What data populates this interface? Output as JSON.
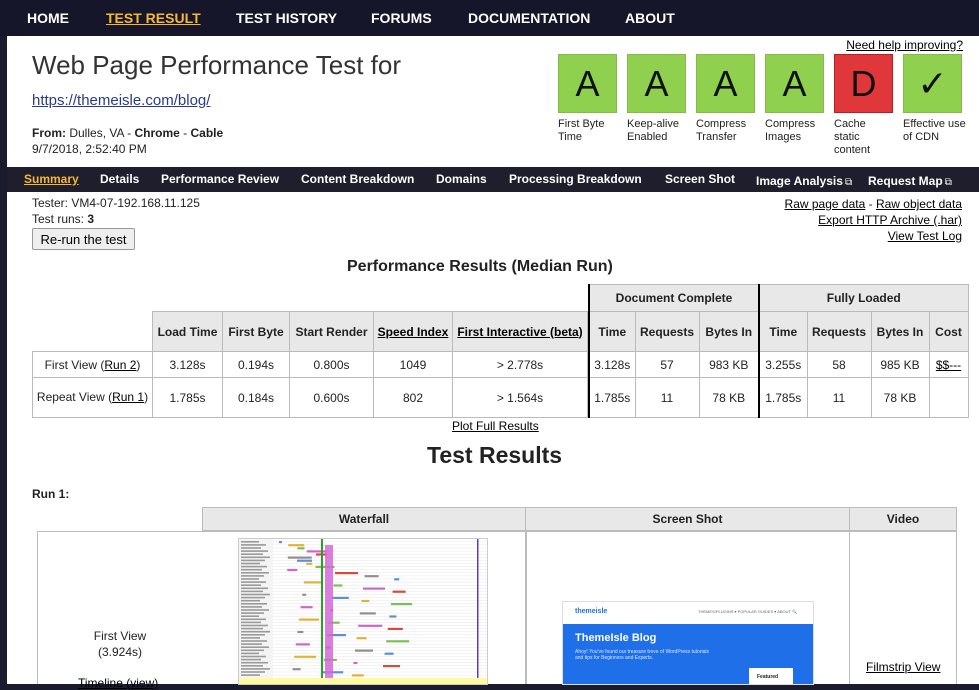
{
  "nav": {
    "items": [
      "HOME",
      "TEST RESULT",
      "TEST HISTORY",
      "FORUMS",
      "DOCUMENTATION",
      "ABOUT"
    ],
    "active": "TEST RESULT"
  },
  "header": {
    "help_link": "Need help improving?",
    "title": "Web Page Performance Test for",
    "url": "https://themeisle.com/blog/",
    "from_label": "From:",
    "from_location": "Dulles, VA",
    "from_sep": " - ",
    "browser": "Chrome",
    "connection": "Cable",
    "date": "9/7/2018, 2:52:40 PM"
  },
  "grades": [
    {
      "grade": "A",
      "label": "First Byte Time",
      "color": "#8fd14f"
    },
    {
      "grade": "A",
      "label": "Keep-alive Enabled",
      "color": "#8fd14f"
    },
    {
      "grade": "A",
      "label": "Compress Transfer",
      "color": "#8fd14f"
    },
    {
      "grade": "A",
      "label": "Compress Images",
      "color": "#8fd14f"
    },
    {
      "grade": "D",
      "label": "Cache static content",
      "color": "#e0383a"
    },
    {
      "grade": "✓",
      "label": "Effective use of CDN",
      "color": "#8fd14f"
    }
  ],
  "subnav": {
    "items": [
      "Summary",
      "Details",
      "Performance Review",
      "Content Breakdown",
      "Domains",
      "Processing Breakdown",
      "Screen Shot",
      "Image Analysis",
      "Request Map"
    ],
    "active": "Summary"
  },
  "test_info": {
    "tester_label": "Tester:",
    "tester": "VM4-07-192.168.11.125",
    "runs_label": "Test runs:",
    "runs": "3",
    "rerun_button": "Re-run the test"
  },
  "raw_links": {
    "raw_page": "Raw page data",
    "sep": " - ",
    "raw_object": "Raw object data",
    "export": "Export HTTP Archive (.har)",
    "log": "View Test Log"
  },
  "perf": {
    "title": "Performance Results (Median Run)",
    "group_doc": "Document Complete",
    "group_full": "Fully Loaded",
    "headers": {
      "load_time": "Load Time",
      "first_byte": "First Byte",
      "start_render": "Start Render",
      "speed_index": "Speed Index",
      "first_interactive": "First Interactive (beta)",
      "time": "Time",
      "requests": "Requests",
      "bytes_in": "Bytes In",
      "cost": "Cost"
    },
    "rows": [
      {
        "label": "First View (",
        "run_link": "Run 2",
        "label_end": ")",
        "load_time": "3.128s",
        "first_byte": "0.194s",
        "start_render": "0.800s",
        "speed_index": "1049",
        "first_interactive": "> 2.778s",
        "doc_time": "3.128s",
        "doc_requests": "57",
        "doc_bytes": "983 KB",
        "full_time": "3.255s",
        "full_requests": "58",
        "full_bytes": "985 KB",
        "cost": "$$---"
      },
      {
        "label": "Repeat View (",
        "run_link": "Run 1",
        "label_end": ")",
        "load_time": "1.785s",
        "first_byte": "0.184s",
        "start_render": "0.600s",
        "speed_index": "802",
        "first_interactive": "> 1.564s",
        "doc_time": "1.785s",
        "doc_requests": "11",
        "doc_bytes": "78 KB",
        "full_time": "1.785s",
        "full_requests": "11",
        "full_bytes": "78 KB",
        "cost": ""
      }
    ],
    "plot_link": "Plot Full Results"
  },
  "results": {
    "title": "Test Results",
    "run_label": "Run 1:",
    "col_waterfall": "Waterfall",
    "col_screenshot": "Screen Shot",
    "col_video": "Video",
    "first_view": "First View",
    "first_view_time": "(3.924s)",
    "timeline_link": "Timeline (view)",
    "filmstrip_link": "Filmstrip View"
  },
  "screenshot_preview": {
    "logo": "themeisle",
    "nav": "THEMES/PLUGINS ▾   POPULAR GUIDES ▾   ABOUT   🔍",
    "hero_title": "ThemeIsle Blog",
    "hero_sub": "Ahoy! You've found our treasure trove of WordPress tutorials and tips for Beginners and Experts.",
    "card": "Featured"
  }
}
